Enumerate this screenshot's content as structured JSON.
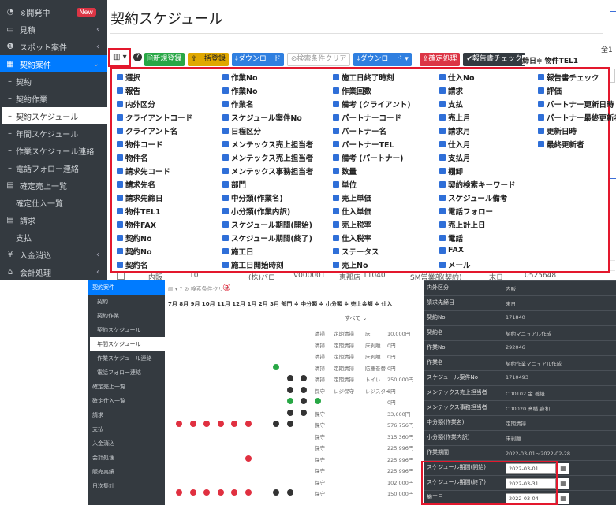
{
  "sidebar": {
    "items": [
      {
        "label": "※開発中",
        "badge": "New",
        "icon": "dashboard-icon"
      },
      {
        "label": "見積",
        "icon": "monitor-icon",
        "chevron": "‹"
      },
      {
        "label": "スポット案件",
        "icon": "info-icon",
        "chevron": "‹"
      },
      {
        "label": "契約案件",
        "icon": "calendar-icon",
        "chevron": "⌄"
      },
      {
        "label": "契約"
      },
      {
        "label": "契約作業"
      },
      {
        "label": "契約スケジュール"
      },
      {
        "label": "年間スケジュール"
      },
      {
        "label": "作業スケジュール連絡"
      },
      {
        "label": "電話フォロー連絡"
      },
      {
        "label": "確定売上一覧",
        "icon": "table-icon"
      },
      {
        "label": "確定仕入一覧"
      },
      {
        "label": "請求",
        "icon": "table-icon"
      },
      {
        "label": "支払"
      },
      {
        "label": "入金消込",
        "icon": "yen-icon",
        "chevron": "‹"
      },
      {
        "label": "会計処理",
        "icon": "bank-icon",
        "chevron": "‹"
      }
    ]
  },
  "page": {
    "title": "契約スケジュール",
    "top_right": "全1"
  },
  "toolbar": {
    "new": "新規登録",
    "bulk": "一括登録",
    "download1": "ダウンロード",
    "clear": "検索条件クリア",
    "download2": "ダウンロード ▾",
    "confirm": "確定処理",
    "report": "報告書チェック"
  },
  "columns": [
    [
      "選択",
      "報告",
      "内外区分",
      "クライアントコード",
      "クライアント名",
      "物件コード",
      "物件名",
      "請求先コード",
      "請求先名",
      "請求先締日",
      "物件TEL1",
      "物件FAX",
      "契約No",
      "契約No",
      "契約名"
    ],
    [
      "作業No",
      "作業No",
      "作業名",
      "スケジュール案件No",
      "日程区分",
      "メンテックス売上担当者",
      "メンテックス売上担当者",
      "メンテックス事務担当者",
      "部門",
      "中分類(作業名)",
      "小分類(作業内訳)",
      "スケジュール期間(開始)",
      "スケジュール期間(終了)",
      "施工日",
      "施工日開始時刻"
    ],
    [
      "施工日終了時刻",
      "作業回数",
      "備考 (クライアント)",
      "パートナーコード",
      "パートナー名",
      "パートナーTEL",
      "備考 (パートナー)",
      "数量",
      "単位",
      "売上単価",
      "仕入単価",
      "売上税率",
      "仕入税率",
      "ステータス",
      "売上No"
    ],
    [
      "仕入No",
      "請求",
      "支払",
      "売上月",
      "請求月",
      "仕入月",
      "支払月",
      "棚卸",
      "契約検索キーワード",
      "スケジュール備考",
      "電話フォロー",
      "売上計上日",
      "電話",
      "FAX",
      "メール"
    ],
    [
      "報告書チェック",
      "評価",
      "パートナー更新日時",
      "パートナー最終更新者",
      "更新日時",
      "最終更新者"
    ]
  ],
  "right_table": {
    "header": "締日≑ 物件TEL1",
    "values": [
      "0525648",
      "0525648",
      "0525648",
      "0525648",
      "0525648",
      "0525648",
      "0525648",
      "0525648",
      "0525648"
    ]
  },
  "rows": [
    {
      "type": "内販",
      "no": "10",
      "partner": "(株)バロー",
      "vno": "V000001",
      "store": "恵那店",
      "code": "11040",
      "dept": "SM営業部(契約)",
      "close": "末日",
      "tel": "0525648"
    },
    {
      "type": "内販",
      "no": "10",
      "partner": "(株)バロー",
      "vno": "V000001",
      "store": "恵那店",
      "code": "11040",
      "dept": "SM営業部(契約)",
      "close": "末日",
      "tel": "0525648"
    }
  ],
  "annual": {
    "months": "7月 8月 9月 10月 11月 12月  1月  2月  3月 部門  ≑ 中分類 ≑ 小分類  ≑ 売上金額 ≑ 仕入",
    "filter_all": "すべて ⌄",
    "marker": "②",
    "rows": [
      {
        "dept": "清掃",
        "mid": "定期清掃",
        "sub": "床",
        "amount": "10,000円"
      },
      {
        "dept": "清掃",
        "mid": "定期清掃",
        "sub": "床剥離",
        "amount": "0円"
      },
      {
        "dept": "清掃",
        "mid": "定期清掃",
        "sub": "床剥離",
        "amount": "0円"
      },
      {
        "dept": "清掃",
        "mid": "定期清掃",
        "sub": "防塵巻替",
        "amount": "0円"
      },
      {
        "dept": "清掃",
        "mid": "定期清掃",
        "sub": "トイレ",
        "amount": "250,000円"
      },
      {
        "dept": "保守",
        "mid": "レジ保守",
        "sub": "レジスター",
        "amount": "0円"
      },
      {
        "dept": "",
        "mid": "",
        "sub": "",
        "amount": "0円"
      },
      {
        "dept": "保守",
        "mid": "",
        "sub": "",
        "amount": "33,600円"
      },
      {
        "dept": "保守",
        "mid": "",
        "sub": "",
        "amount": "576,756円"
      },
      {
        "dept": "保守",
        "mid": "",
        "sub": "",
        "amount": "315,360円"
      },
      {
        "dept": "保守",
        "mid": "",
        "sub": "",
        "amount": "225,996円"
      },
      {
        "dept": "保守",
        "mid": "",
        "sub": "",
        "amount": "225,996円"
      },
      {
        "dept": "保守",
        "mid": "",
        "sub": "",
        "amount": "225,996円"
      },
      {
        "dept": "保守",
        "mid": "",
        "sub": "",
        "amount": "102,000円"
      },
      {
        "dept": "保守",
        "mid": "",
        "sub": "",
        "amount": "150,000円"
      }
    ]
  },
  "sidebar2": [
    "契約案件",
    "契約",
    "契約作業",
    "契約スケジュール",
    "年間スケジュール",
    "作業スケジュール連絡",
    "電話フォロー連絡",
    "確定売上一覧",
    "確定仕入一覧",
    "請求",
    "支払",
    "入金消込",
    "会計処理",
    "販売実績",
    "日次集計"
  ],
  "form": {
    "rows": [
      {
        "label": "内外区分",
        "value": "内販"
      },
      {
        "label": "請求先締日",
        "value": "末日"
      },
      {
        "label": "契約No",
        "value": "171840"
      },
      {
        "label": "契約名",
        "value": "契約マニュアル作成"
      },
      {
        "label": "作業No",
        "value": "292046"
      },
      {
        "label": "作業名",
        "value": "契約作業マニュアル作成"
      },
      {
        "label": "スケジュール案件No",
        "value": "1710493"
      },
      {
        "label": "メンテックス売上担当者",
        "value": "CD0102 金 善継"
      },
      {
        "label": "メンテックス事務担当者",
        "value": "CD0020 髙橋 身和"
      },
      {
        "label": "中分類(作業名)",
        "value": "定期清掃"
      },
      {
        "label": "小分類(作業内訳)",
        "value": "床剥離"
      },
      {
        "label": "作業期間",
        "value": "2022-03-01〜2022-02-28"
      },
      {
        "label": "スケジュール期間(開始)",
        "input": "2022-03-01"
      },
      {
        "label": "スケジュール期間(終了)",
        "input": "2022-03-31"
      },
      {
        "label": "施工日",
        "input": "2022-03-04"
      }
    ]
  }
}
